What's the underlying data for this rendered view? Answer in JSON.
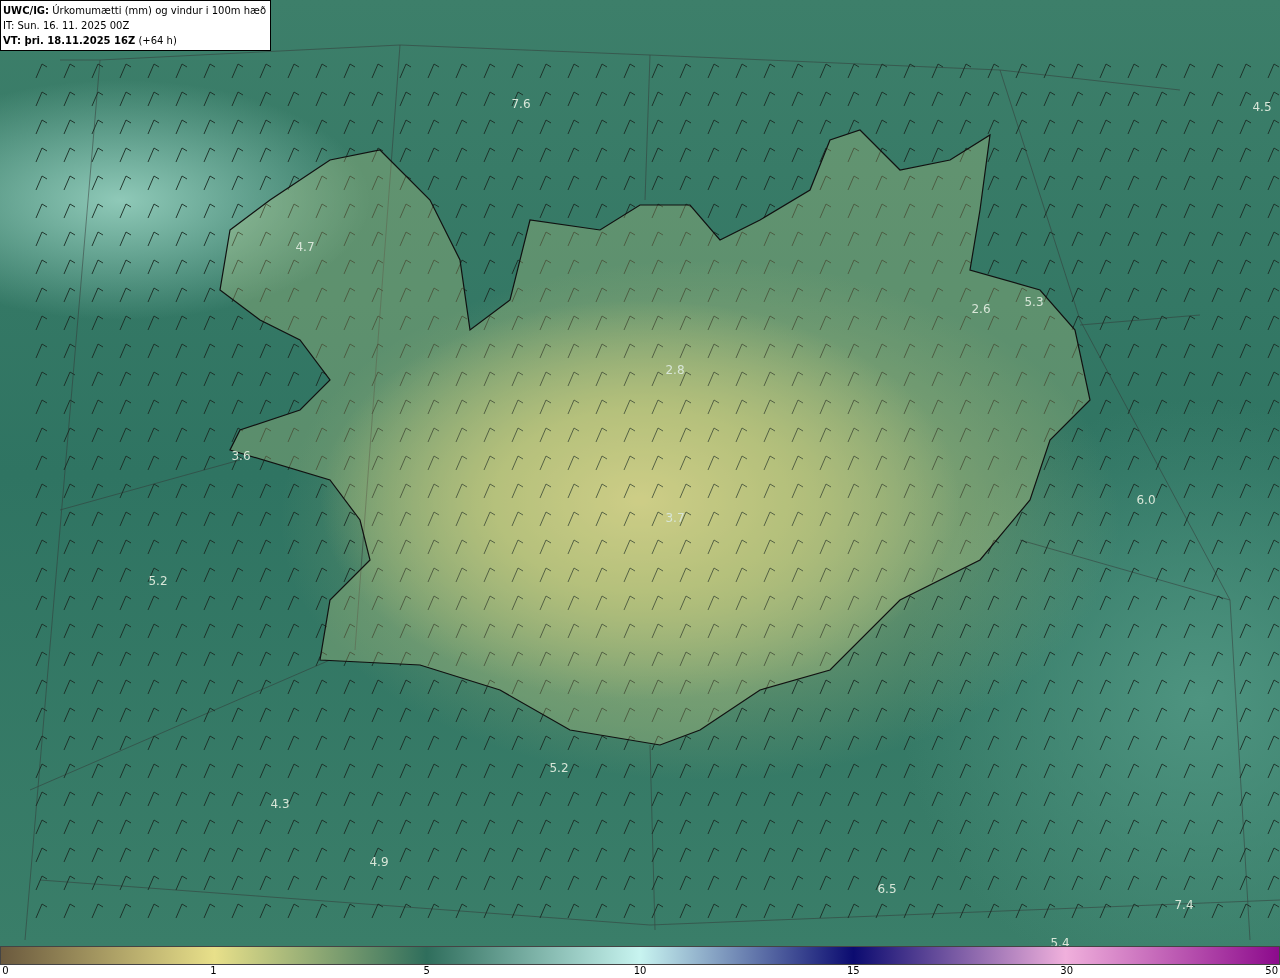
{
  "header": {
    "lines": [
      "**UWC/IG:** Úrkomumætti (mm) og vindur i 100m hæð",
      "IT: Sun. 16. 11. 2025 00Z",
      "**VT: þri. 18.11.2025 16Z** (+64 h)"
    ]
  },
  "map": {
    "value_labels": [
      "7.6",
      "4.5",
      "4.7",
      "5.3",
      "2.6",
      "2.8",
      "3.6",
      "6.0",
      "3.7",
      "5.2",
      "5.2",
      "4.3",
      "4.9",
      "6.5",
      "7.4",
      "5.4"
    ]
  },
  "colorbar": {
    "ticks": [
      "0",
      "1",
      "5",
      "10",
      "15",
      "30",
      "50"
    ]
  }
}
